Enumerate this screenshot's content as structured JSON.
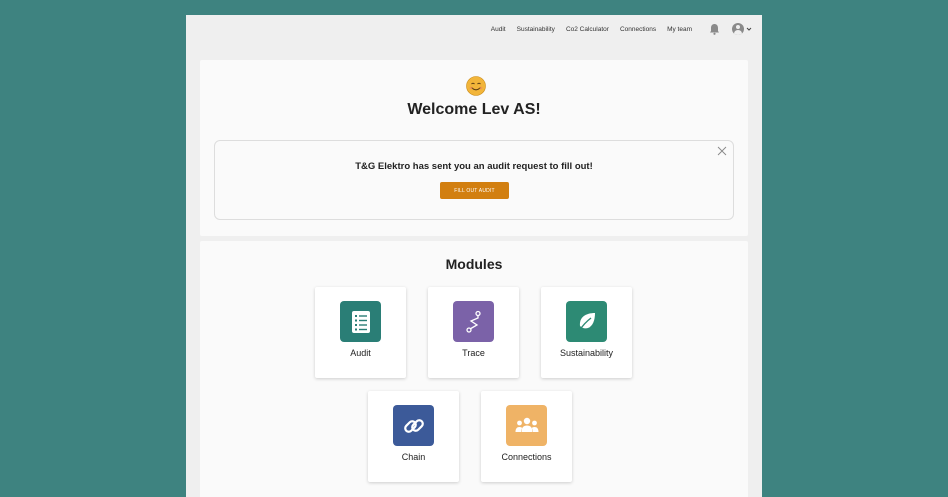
{
  "nav": {
    "links": [
      "Audit",
      "Sustainability",
      "Co2 Calculator",
      "Connections",
      "My team"
    ]
  },
  "welcome": {
    "title": "Welcome Lev AS!",
    "notice_text": "T&G Elektro has sent you an audit request to fill out!",
    "button_label": "FILL OUT AUDIT"
  },
  "modules": {
    "title": "Modules",
    "items": [
      {
        "label": "Audit",
        "icon": "checklist-icon",
        "color": "#2a7e76"
      },
      {
        "label": "Trace",
        "icon": "route-icon",
        "color": "#7b62a8"
      },
      {
        "label": "Sustainability",
        "icon": "leaf-icon",
        "color": "#2d8a74"
      },
      {
        "label": "Chain",
        "icon": "link-icon",
        "color": "#3c5a99"
      },
      {
        "label": "Connections",
        "icon": "people-icon",
        "color": "#efb366"
      }
    ]
  },
  "colors": {
    "background": "#3e8380",
    "accent_button": "#d27f10"
  }
}
